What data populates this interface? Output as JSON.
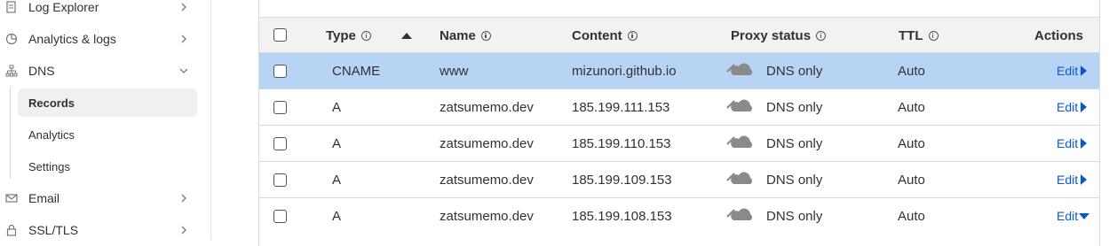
{
  "sidebar": {
    "items": [
      {
        "label": "Log Explorer",
        "icon": "log-explorer-icon"
      },
      {
        "label": "Analytics & logs",
        "icon": "analytics-icon"
      },
      {
        "label": "DNS",
        "icon": "dns-icon"
      },
      {
        "label": "Email",
        "icon": "email-icon"
      },
      {
        "label": "SSL/TLS",
        "icon": "lock-icon"
      }
    ],
    "dns_subitems": [
      {
        "label": "Records",
        "active": true
      },
      {
        "label": "Analytics",
        "active": false
      },
      {
        "label": "Settings",
        "active": false
      }
    ]
  },
  "table": {
    "headers": {
      "type": "Type",
      "name": "Name",
      "content": "Content",
      "proxy": "Proxy status",
      "ttl": "TTL",
      "actions": "Actions"
    },
    "sort": {
      "column": "Type",
      "direction": "ascending"
    },
    "rows": [
      {
        "type": "CNAME",
        "name": "www",
        "content": "mizunori.github.io",
        "proxy": "DNS only",
        "ttl": "Auto",
        "action": "Edit",
        "selected": true,
        "expanded": false
      },
      {
        "type": "A",
        "name": "zatsumemo.dev",
        "content": "185.199.111.153",
        "proxy": "DNS only",
        "ttl": "Auto",
        "action": "Edit",
        "selected": false,
        "expanded": false
      },
      {
        "type": "A",
        "name": "zatsumemo.dev",
        "content": "185.199.110.153",
        "proxy": "DNS only",
        "ttl": "Auto",
        "action": "Edit",
        "selected": false,
        "expanded": false
      },
      {
        "type": "A",
        "name": "zatsumemo.dev",
        "content": "185.199.109.153",
        "proxy": "DNS only",
        "ttl": "Auto",
        "action": "Edit",
        "selected": false,
        "expanded": false
      },
      {
        "type": "A",
        "name": "zatsumemo.dev",
        "content": "185.199.108.153",
        "proxy": "DNS only",
        "ttl": "Auto",
        "action": "Edit",
        "selected": false,
        "expanded": true
      }
    ]
  },
  "colors": {
    "selected_row": "#b7d4f5",
    "link": "#0a58d0",
    "header_bg": "#f2f2f2",
    "cloud_grey": "#8a8a8a"
  }
}
